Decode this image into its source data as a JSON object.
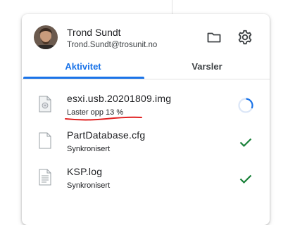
{
  "header": {
    "user_name": "Trond Sundt",
    "user_email": "Trond.Sundt@trosunit.no",
    "icons": {
      "folder": "folder-icon",
      "settings": "gear-icon"
    }
  },
  "tabs": [
    {
      "label": "Aktivitet",
      "active": true
    },
    {
      "label": "Varsler",
      "active": false
    }
  ],
  "files": [
    {
      "name": "esxi.usb.20201809.img",
      "status": "Laster opp 13 %",
      "state": "uploading",
      "icon": "disk-image-file-icon",
      "progress_percent": 13
    },
    {
      "name": "PartDatabase.cfg",
      "status": "Synkronisert",
      "state": "synced",
      "icon": "blank-file-icon"
    },
    {
      "name": "KSP.log",
      "status": "Synkronisert",
      "state": "synced",
      "icon": "text-file-icon"
    }
  ],
  "colors": {
    "accent": "#1a73e8",
    "success": "#188038",
    "annotation": "#e02020"
  }
}
